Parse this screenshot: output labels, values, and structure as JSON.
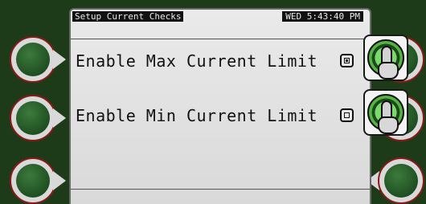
{
  "header": {
    "screen_title": "Setup Current Checks",
    "clock": "WED 5:43:40 PM"
  },
  "options": [
    {
      "label": "Enable Max Current Limit",
      "checked": true
    },
    {
      "label": "Enable Min Current Limit",
      "checked": false
    }
  ],
  "colors": {
    "bezel": "#1d3b18",
    "screen_bg": "#e3e3e3",
    "knob_green": "#2d6b2e",
    "knob_ring": "#8a1a1a",
    "dial_green": "#53b441"
  },
  "icons": {
    "softkey": "green-round-knob-icon",
    "touch_hint": "hand-on-dial-icon"
  }
}
